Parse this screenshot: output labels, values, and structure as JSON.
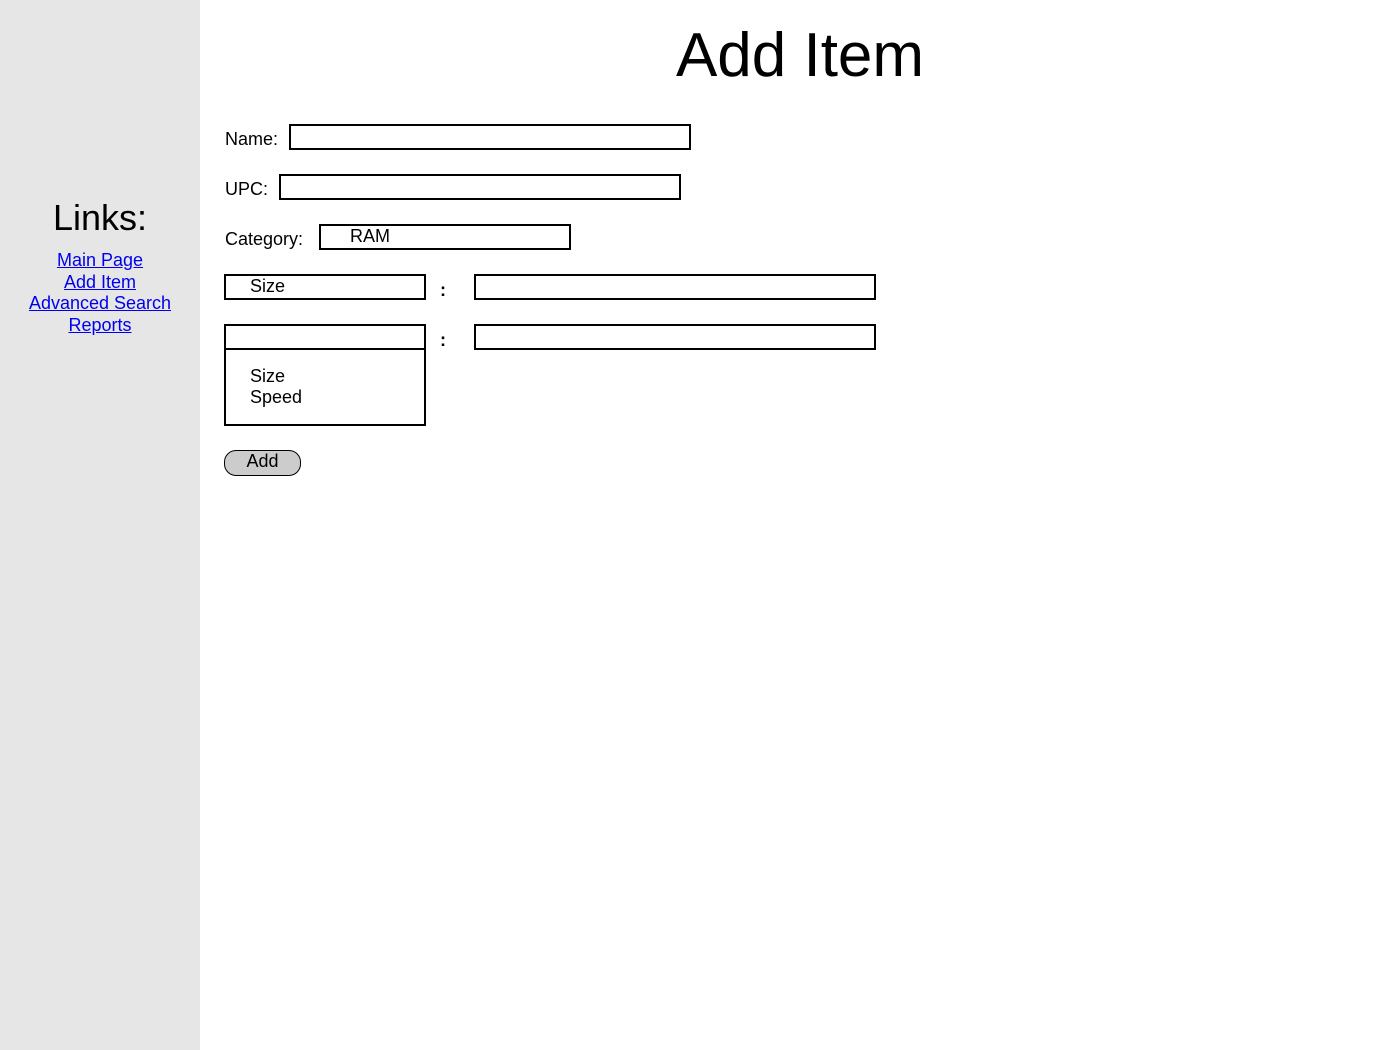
{
  "sidebar": {
    "title": "Links:",
    "links": [
      "Main Page",
      "Add Item",
      "Advanced Search",
      "Reports"
    ]
  },
  "page": {
    "title": "Add Item"
  },
  "form": {
    "name_label": "Name:",
    "name_value": "",
    "upc_label": "UPC:",
    "upc_value": "",
    "category_label": "Category:",
    "category_value": "RAM",
    "attributes": [
      {
        "key": "Size",
        "separator": ":",
        "value": ""
      },
      {
        "key": "",
        "separator": ":",
        "value": ""
      }
    ],
    "attribute_options": [
      "Size",
      "Speed"
    ],
    "add_button_label": "Add"
  },
  "colors": {
    "sidebar_bg": "#e6e6e6",
    "link": "#0000ee",
    "button_bg": "#cccccc"
  }
}
